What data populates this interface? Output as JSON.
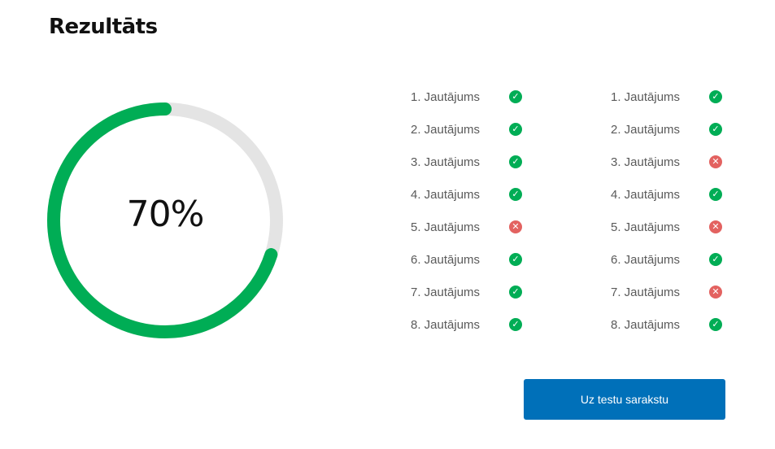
{
  "header": {
    "title": "Rezultāts"
  },
  "result": {
    "percent_label": "70%",
    "percent_value": 70
  },
  "colors": {
    "correct": "#00ad55",
    "wrong": "#e36260",
    "track": "#e4e4e4",
    "button": "#0070b9"
  },
  "answers_left": [
    {
      "label": "1. Jautājums",
      "status": "correct",
      "icon": "check-circle-icon"
    },
    {
      "label": "2. Jautājums",
      "status": "correct",
      "icon": "check-circle-icon"
    },
    {
      "label": "3. Jautājums",
      "status": "correct",
      "icon": "check-circle-icon"
    },
    {
      "label": "4. Jautājums",
      "status": "correct",
      "icon": "check-circle-icon"
    },
    {
      "label": "5. Jautājums",
      "status": "wrong",
      "icon": "x-circle-icon"
    },
    {
      "label": "6. Jautājums",
      "status": "correct",
      "icon": "check-circle-icon"
    },
    {
      "label": "7. Jautājums",
      "status": "correct",
      "icon": "check-circle-icon"
    },
    {
      "label": "8. Jautājums",
      "status": "correct",
      "icon": "check-circle-icon"
    }
  ],
  "answers_right": [
    {
      "label": "1. Jautājums",
      "status": "correct",
      "icon": "check-circle-icon"
    },
    {
      "label": "2. Jautājums",
      "status": "correct",
      "icon": "check-circle-icon"
    },
    {
      "label": "3. Jautājums",
      "status": "wrong",
      "icon": "x-circle-icon"
    },
    {
      "label": "4. Jautājums",
      "status": "correct",
      "icon": "check-circle-icon"
    },
    {
      "label": "5. Jautājums",
      "status": "wrong",
      "icon": "x-circle-icon"
    },
    {
      "label": "6. Jautājums",
      "status": "correct",
      "icon": "check-circle-icon"
    },
    {
      "label": "7. Jautājums",
      "status": "wrong",
      "icon": "x-circle-icon"
    },
    {
      "label": "8. Jautājums",
      "status": "correct",
      "icon": "check-circle-icon"
    }
  ],
  "button": {
    "label": "Uz testu sarakstu"
  }
}
